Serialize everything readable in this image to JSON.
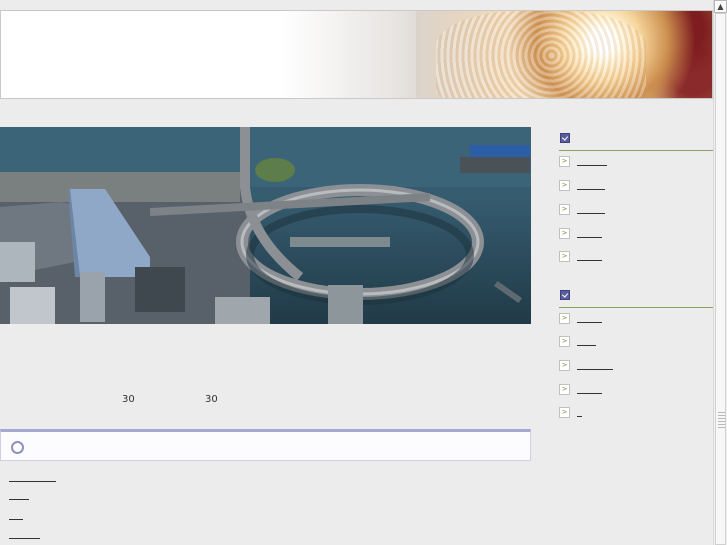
{
  "header": {
    "image": "lamp-photo-banner"
  },
  "hero": {
    "image": "aerial-loop-bridge-photo"
  },
  "intro": {
    "text_a": "30",
    "text_b": "30"
  },
  "news": {
    "icon": "circle-icon",
    "links": [
      "",
      "",
      "",
      ""
    ]
  },
  "sidebar": {
    "section1": {
      "icon": "check-icon",
      "items": [
        "",
        "",
        "",
        "",
        ""
      ]
    },
    "section2": {
      "icon": "check-icon",
      "items": [
        "",
        "",
        "",
        "",
        ""
      ]
    }
  },
  "scrollbar": {
    "up_icon": "▲"
  }
}
